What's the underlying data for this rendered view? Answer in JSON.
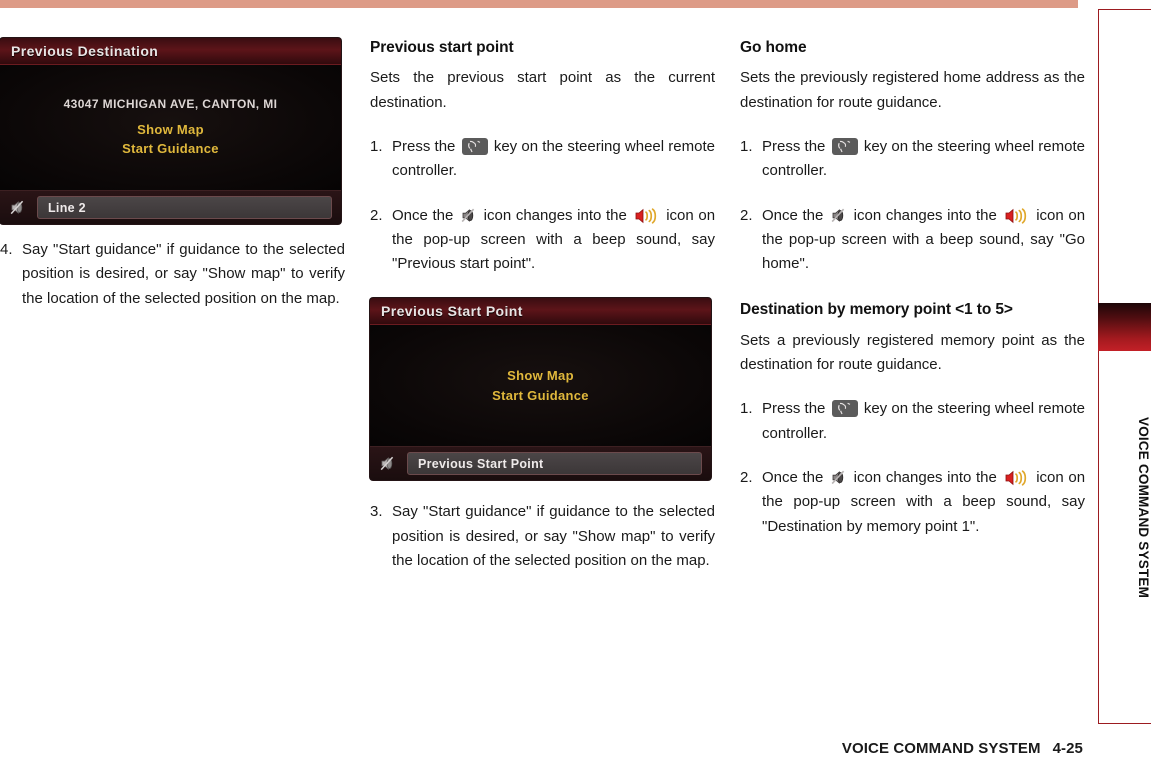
{
  "page": {
    "footer_title": "VOICE COMMAND SYSTEM",
    "footer_page": "4-25",
    "side_tab_label": "VOICE COMMAND SYSTEM",
    "accent_salmon": "#dd9b87",
    "accent_red": "#9c1b20"
  },
  "left_column": {
    "shot": {
      "title": "Previous Destination",
      "address": "43047 MICHIGAN AVE, CANTON, MI",
      "command_1": "Show Map",
      "command_2": "Start Guidance",
      "status_text": "Line 2",
      "mute_icon": "speaker-mute-icon"
    },
    "step": {
      "number": "4.",
      "text": "Say \"Start guidance\" if guidance to the selected position is desired, or say \"Show map\" to verify the location of the selected position on the map."
    }
  },
  "middle_column": {
    "title": "Previous start point",
    "intro": "Sets the previous start point as the current destination.",
    "step1": {
      "number": "1.",
      "before_icon": "Press the",
      "key_icon": "steering-wheel-voice-key-icon",
      "after_icon": "key on the steering wheel remote controller."
    },
    "step2": {
      "number": "2.",
      "part1": "Once the",
      "mute_icon": "speaker-mute-icon",
      "part2": "icon changes into the",
      "active_icon": "speaker-active-icon",
      "part3": "icon on the pop-up screen with a beep sound, say \"Previous start point\"."
    },
    "shot": {
      "title": "Previous Start Point",
      "command_1": "Show Map",
      "command_2": "Start Guidance",
      "status_text": "Previous Start Point",
      "mute_icon": "speaker-mute-icon"
    },
    "step3": {
      "number": "3.",
      "text": "Say \"Start guidance\" if guidance to the selected position is desired, or say \"Show map\" to verify the location of the selected position on the map."
    }
  },
  "right_column": {
    "section_go_home": {
      "title": "Go home",
      "intro": "Sets the previously registered home address as the destination for route guidance.",
      "step1": {
        "number": "1.",
        "before_icon": "Press the",
        "key_icon": "steering-wheel-voice-key-icon",
        "after_icon": "key on the steering wheel remote controller."
      },
      "step2": {
        "number": "2.",
        "part1": "Once the",
        "mute_icon": "speaker-mute-icon",
        "part2": "icon changes into the",
        "active_icon": "speaker-active-icon",
        "part3": "icon on the pop-up screen with a beep sound, say \"Go home\"."
      }
    },
    "section_memory_point": {
      "title": "Destination by memory point <1 to 5>",
      "intro": "Sets a previously registered memory point as the destination for route guidance.",
      "step1": {
        "number": "1.",
        "before_icon": "Press the",
        "key_icon": "steering-wheel-voice-key-icon",
        "after_icon": "key on the steering wheel remote controller."
      },
      "step2": {
        "number": "2.",
        "part1": "Once the",
        "mute_icon": "speaker-mute-icon",
        "part2": "icon changes into the",
        "active_icon": "speaker-active-icon",
        "part3": "icon on the pop-up screen with a beep sound, say \"Destination by memory point 1\"."
      }
    }
  }
}
